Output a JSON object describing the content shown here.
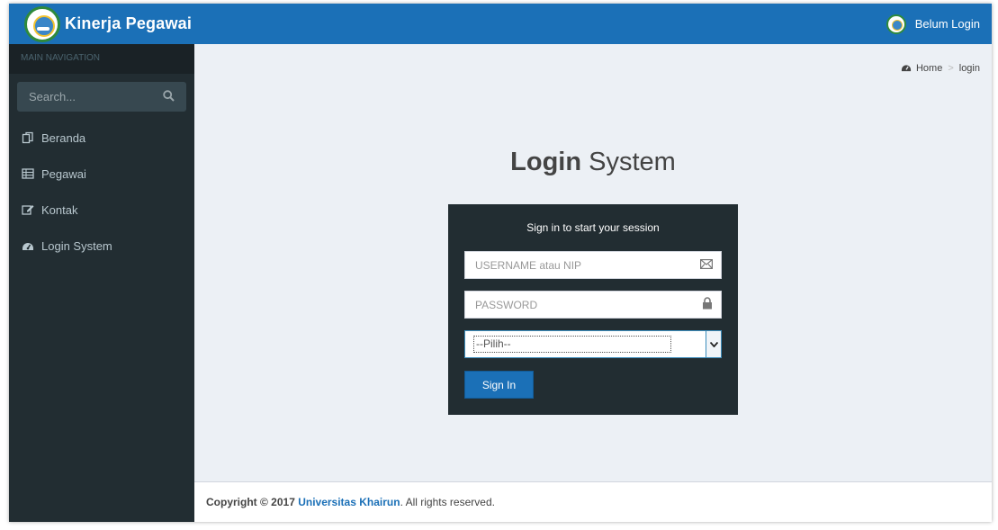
{
  "header": {
    "brand": "Kinerja Pegawai",
    "user_label": "Belum Login"
  },
  "sidebar": {
    "nav_header": "MAIN NAVIGATION",
    "search_placeholder": "Search...",
    "items": [
      {
        "label": "Beranda",
        "icon": "copy-icon"
      },
      {
        "label": "Pegawai",
        "icon": "table-icon"
      },
      {
        "label": "Kontak",
        "icon": "edit-icon"
      },
      {
        "label": "Login System",
        "icon": "dashboard-icon"
      }
    ]
  },
  "breadcrumb": {
    "home": "Home",
    "sep": ">",
    "current": "login"
  },
  "page": {
    "title_bold": "Login",
    "title_light": "System"
  },
  "login": {
    "message": "Sign in to start your session",
    "username_placeholder": "USERNAME atau NIP",
    "password_placeholder": "PASSWORD",
    "select_value": "--Pilih--",
    "signin_label": "Sign In"
  },
  "footer": {
    "prefix": "Copyright © 2017 ",
    "org": "Universitas Khairun",
    "suffix": ". All rights reserved."
  },
  "colors": {
    "header_bg": "#1b70b7",
    "sidebar_bg": "#222d32",
    "content_bg": "#ecf0f5",
    "accent": "#1b70b7"
  }
}
